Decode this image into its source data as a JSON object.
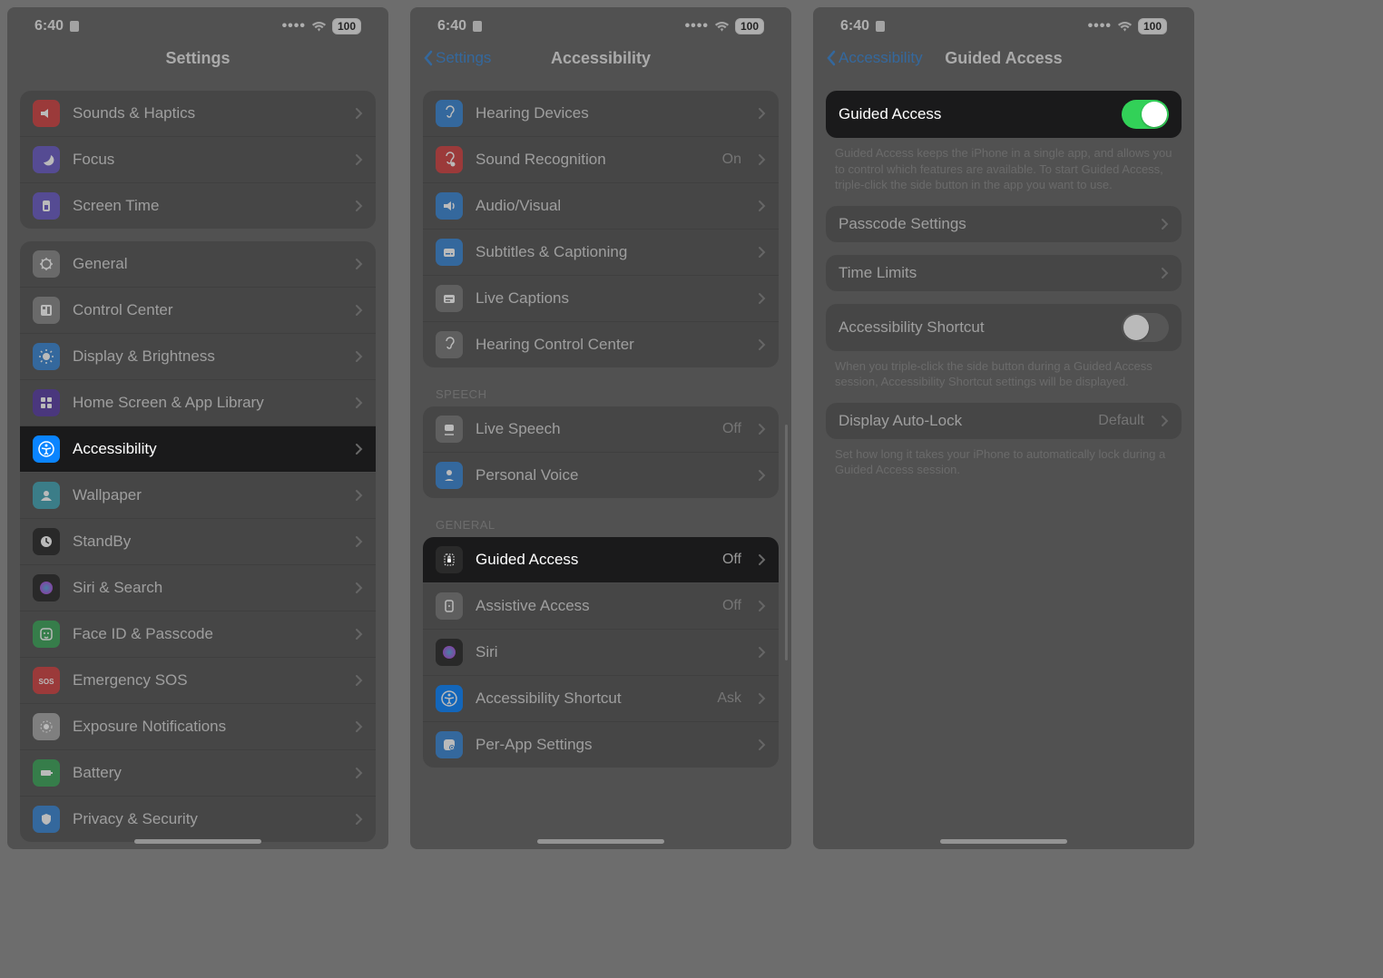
{
  "status": {
    "time": "6:40",
    "battery": "100"
  },
  "icon_colors": {
    "sounds": "#d24343",
    "focus": "#6a5cc6",
    "screentime": "#6a5cc6",
    "general": "#8a8a8a",
    "controlcenter": "#8a8a8a",
    "display": "#3a86d4",
    "homescreen": "#5a3ea6",
    "accessibility": "#0a84ff",
    "wallpaper": "#44a5b5",
    "standby": "#2a2a2a",
    "siri": "#2a2a2a",
    "faceid": "#3da55a",
    "sos": "#d24343",
    "exposure": "#a8a8a8",
    "battery": "#3da55a",
    "privacy": "#3a86d4",
    "hearing": "#3a86d4",
    "soundrec": "#d24343",
    "audiovisual": "#3a86d4",
    "subtitles": "#3a86d4",
    "livecaptions": "#7a7a7a",
    "hearingcc": "#7a7a7a",
    "livespeech": "#7a7a7a",
    "personalvoice": "#3a86d4",
    "guided": "#2a2a2a",
    "assistive": "#7a7a7a",
    "shortcut": "#0a84ff",
    "perapp": "#3a86d4"
  },
  "screen1": {
    "title": "Settings",
    "groupA": [
      {
        "id": "sounds",
        "label": "Sounds & Haptics"
      },
      {
        "id": "focus",
        "label": "Focus"
      },
      {
        "id": "screentime",
        "label": "Screen Time"
      }
    ],
    "groupB": [
      {
        "id": "general",
        "label": "General"
      },
      {
        "id": "controlcenter",
        "label": "Control Center"
      },
      {
        "id": "display",
        "label": "Display & Brightness"
      },
      {
        "id": "homescreen",
        "label": "Home Screen & App Library"
      },
      {
        "id": "accessibility",
        "label": "Accessibility",
        "highlight": true
      },
      {
        "id": "wallpaper",
        "label": "Wallpaper"
      },
      {
        "id": "standby",
        "label": "StandBy"
      },
      {
        "id": "siri",
        "label": "Siri & Search"
      },
      {
        "id": "faceid",
        "label": "Face ID & Passcode"
      },
      {
        "id": "sos",
        "label": "Emergency SOS"
      },
      {
        "id": "exposure",
        "label": "Exposure Notifications"
      },
      {
        "id": "battery",
        "label": "Battery"
      },
      {
        "id": "privacy",
        "label": "Privacy & Security"
      }
    ]
  },
  "screen2": {
    "back": "Settings",
    "title": "Accessibility",
    "hearing": [
      {
        "id": "hearing",
        "label": "Hearing Devices"
      },
      {
        "id": "soundrec",
        "label": "Sound Recognition",
        "value": "On"
      },
      {
        "id": "audiovisual",
        "label": "Audio/Visual"
      },
      {
        "id": "subtitles",
        "label": "Subtitles & Captioning"
      },
      {
        "id": "livecaptions",
        "label": "Live Captions"
      },
      {
        "id": "hearingcc",
        "label": "Hearing Control Center"
      }
    ],
    "speech_header": "SPEECH",
    "speech": [
      {
        "id": "livespeech",
        "label": "Live Speech",
        "value": "Off"
      },
      {
        "id": "personalvoice",
        "label": "Personal Voice"
      }
    ],
    "general_header": "GENERAL",
    "general": [
      {
        "id": "guided",
        "label": "Guided Access",
        "value": "Off",
        "highlight": true
      },
      {
        "id": "assistive",
        "label": "Assistive Access",
        "value": "Off"
      },
      {
        "id": "siri",
        "label": "Siri"
      },
      {
        "id": "shortcut",
        "label": "Accessibility Shortcut",
        "value": "Ask"
      },
      {
        "id": "perapp",
        "label": "Per-App Settings"
      }
    ]
  },
  "screen3": {
    "back": "Accessibility",
    "title": "Guided Access",
    "ga_toggle_label": "Guided Access",
    "ga_toggle_on": true,
    "ga_footer": "Guided Access keeps the iPhone in a single app, and allows you to control which features are available. To start Guided Access, triple-click the side button in the app you want to use.",
    "passcode": "Passcode Settings",
    "timelimits": "Time Limits",
    "shortcut_label": "Accessibility Shortcut",
    "shortcut_on": false,
    "shortcut_footer": "When you triple-click the side button during a Guided Access session, Accessibility Shortcut settings will be displayed.",
    "autolock_label": "Display Auto-Lock",
    "autolock_value": "Default",
    "autolock_footer": "Set how long it takes your iPhone to automatically lock during a Guided Access session."
  }
}
